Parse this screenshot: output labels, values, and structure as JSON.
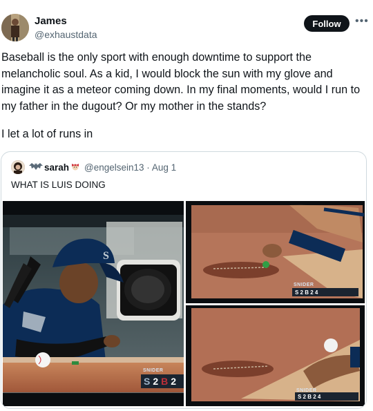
{
  "author": {
    "name": "James",
    "handle": "@exhaustdata"
  },
  "follow_label": "Follow",
  "more_icon": "more-horizontal-icon",
  "tweet": {
    "text": "Baseball is the only sport with enough downtime to support the melancholic soul. As a kid, I would block the sun with my glove and imagine it as a meteor coming down. In my final moments, would I run to my father in the dugout? Or my mother in the stands?",
    "text2": "I let a lot of runs in"
  },
  "quote": {
    "name": "sarah",
    "handle": "@engelsein13",
    "separator": "·",
    "date": "Aug 1",
    "text": "WHAT IS LUIS DOING",
    "images": {
      "main": {
        "score_label": "SNIDER",
        "team_a": "S",
        "score_a": "2",
        "team_b": "B",
        "score_b": "2"
      },
      "top_right": {
        "score_label": "SNIDER",
        "score_text": "S 2 B 2 4"
      },
      "bottom_right": {
        "score_label": "SNIDER",
        "score_text": "S 2 B 2 4"
      }
    }
  },
  "colors": {
    "text": "#0f1419",
    "secondary": "#536471",
    "border": "#cfd9de",
    "follow_bg": "#0f1419",
    "mariners_navy": "#0c2c56",
    "red_sox_red": "#bd3039"
  }
}
